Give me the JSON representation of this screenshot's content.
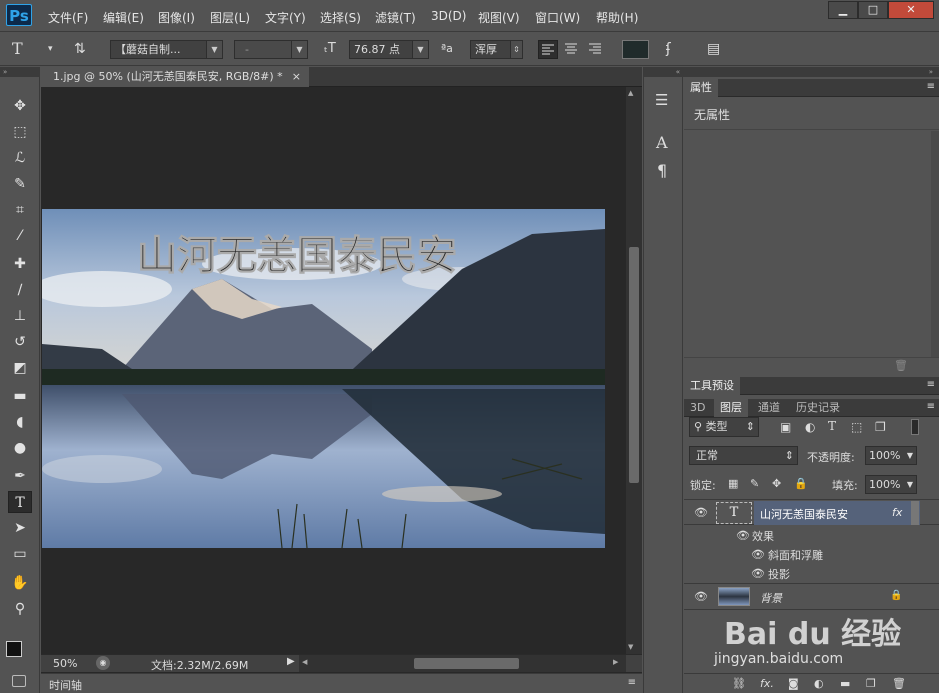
{
  "app": {
    "logo": "Ps"
  },
  "menu": [
    "文件(F)",
    "编辑(E)",
    "图像(I)",
    "图层(L)",
    "文字(Y)",
    "选择(S)",
    "滤镜(T)",
    "3D(D)",
    "视图(V)",
    "窗口(W)",
    "帮助(H)"
  ],
  "window_controls": {
    "minimize": "▁",
    "maximize": "□",
    "close": "✕"
  },
  "options": {
    "font_family": "【蘑菇自制...",
    "font_style": "-",
    "font_size": "76.87 点",
    "aa_label": "ªa",
    "antialias": "浑厚"
  },
  "document": {
    "tab_title": "1.jpg @ 50% (山河无恙国泰民安, RGB/8#) *",
    "tab_close": "×",
    "canvas_text": "山河无恙国泰民安"
  },
  "status": {
    "zoom": "50%",
    "doc_info": "文档:2.32M/2.69M"
  },
  "timeline": {
    "label": "时间轴"
  },
  "properties": {
    "tab": "属性",
    "content": "无属性"
  },
  "tool_presets": {
    "tab": "工具预设"
  },
  "layers_panel": {
    "tabs": [
      "3D",
      "图层",
      "通道",
      "历史记录"
    ],
    "active_tab": "图层",
    "filter_kind": "类型",
    "blend_mode": "正常",
    "opacity_label": "不透明度:",
    "opacity_value": "100%",
    "lock_label": "锁定:",
    "fill_label": "填充:",
    "fill_value": "100%",
    "layers": [
      {
        "name": "山河无恙国泰民安",
        "fx": "fx",
        "thumb": "T"
      },
      {
        "name": "背景"
      }
    ],
    "effects_label": "效果",
    "effects": [
      "斜面和浮雕",
      "投影"
    ]
  },
  "watermark": {
    "brand": "Bai du 经验",
    "url": "jingyan.baidu.com"
  },
  "colors": {
    "accent": "#2fa3e8",
    "selected_layer": "#55627a",
    "doc_bg": "#282828"
  }
}
